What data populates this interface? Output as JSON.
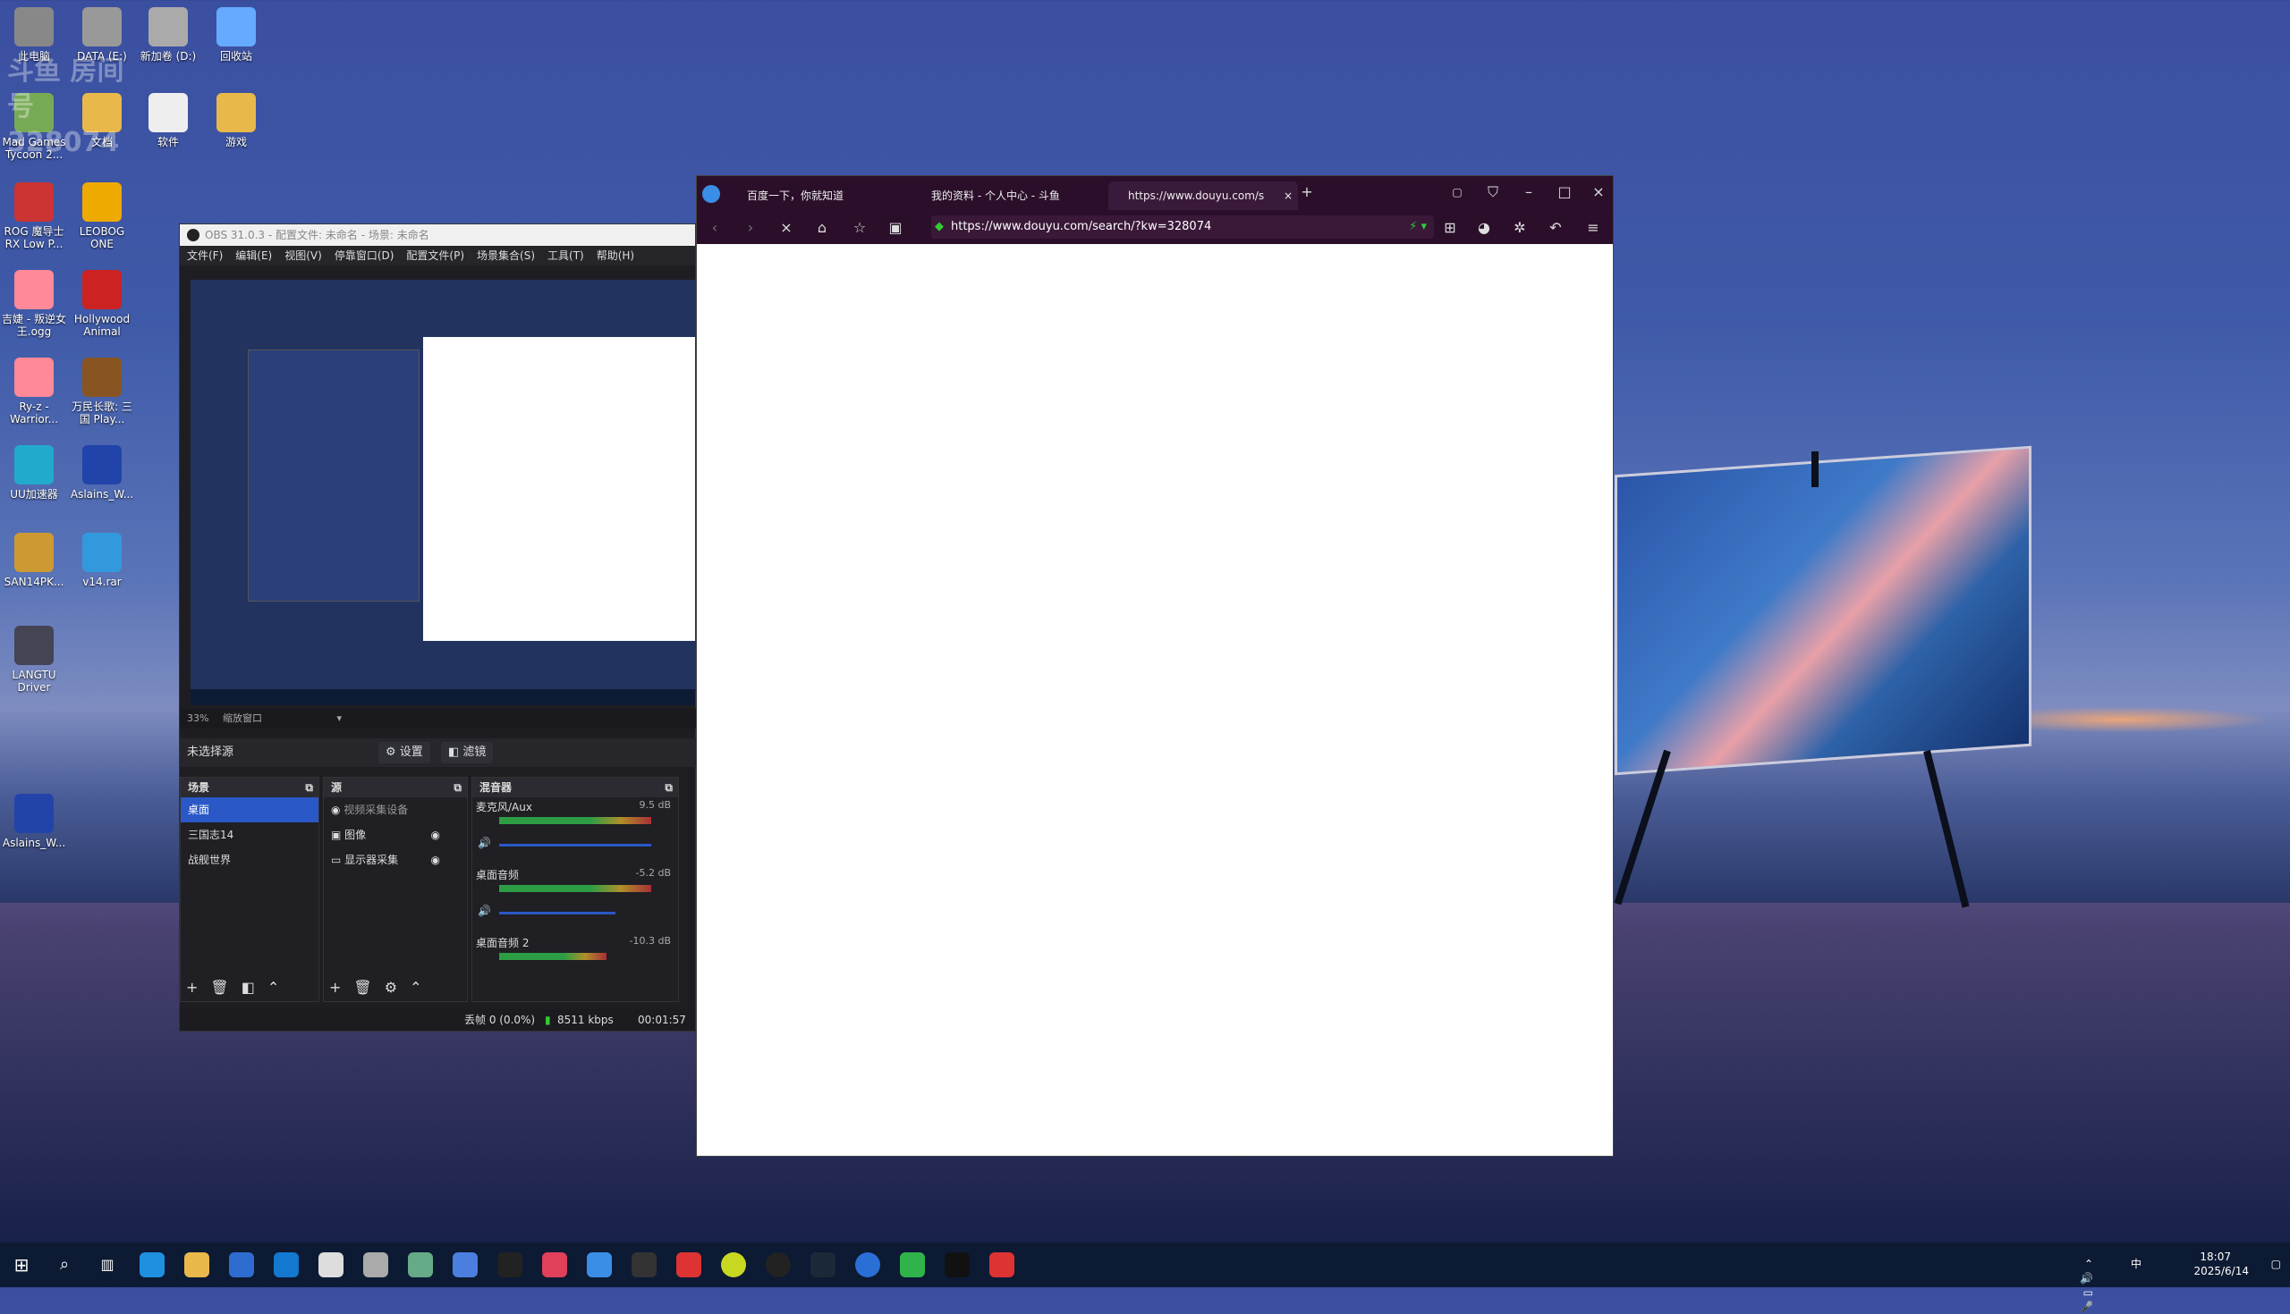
{
  "desktop": {
    "icons": [
      {
        "label": "此电脑"
      },
      {
        "label": "DATA (E:)"
      },
      {
        "label": "新加卷 (D:)"
      },
      {
        "label": "回收站"
      },
      {
        "label": "Mad Games Tycoon 2..."
      },
      {
        "label": "文档"
      },
      {
        "label": "软件"
      },
      {
        "label": "游戏"
      },
      {
        "label": "ROG 魔导士 RX Low P..."
      },
      {
        "label": "LEOBOG ONE"
      },
      {
        "label": "吉婕 - 叛逆女王.ogg"
      },
      {
        "label": "Hollywood Animal"
      },
      {
        "label": "Ry-z - Warrior..."
      },
      {
        "label": "万民长歌: 三国 Play..."
      },
      {
        "label": "UU加速器"
      },
      {
        "label": "Aslains_W..."
      },
      {
        "label": "SAN14PK..."
      },
      {
        "label": "v14.rar"
      },
      {
        "label": "LANGTU Driver"
      },
      {
        "label": "Aslains_W..."
      }
    ],
    "watermark": "斗鱼 房间号 328074"
  },
  "obs": {
    "title": "OBS 31.0.3 - 配置文件: 未命名 - 场景: 未命名",
    "menu": [
      "文件(F)",
      "编辑(E)",
      "视图(V)",
      "停靠窗口(D)",
      "配置文件(P)",
      "场景集合(S)",
      "工具(T)",
      "帮助(H)"
    ],
    "zoom": "33%",
    "zoom_mode": "缩放窗口",
    "context_label": "未选择源",
    "settings_btn": "设置",
    "filters_btn": "滤镜",
    "scenes_title": "场景",
    "scenes": [
      "桌面",
      "三国志14",
      "战舰世界"
    ],
    "sources_title": "源",
    "sources": [
      "视频采集设备",
      "图像",
      "显示器采集"
    ],
    "mixer_title": "混音器",
    "mixer": [
      {
        "name": "麦克风/Aux",
        "db": "9.5 dB"
      },
      {
        "name": "桌面音频",
        "db": "-5.2 dB"
      },
      {
        "name": "桌面音频 2",
        "db": "-10.3 dB"
      }
    ],
    "status_dropped": "丢帧 0 (0.0%)",
    "status_bitrate": "8511 kbps",
    "status_time": "00:01:57"
  },
  "browser": {
    "tabs": [
      {
        "label": "百度一下，你就知道"
      },
      {
        "label": "我的资料 - 个人中心 - 斗鱼"
      },
      {
        "label": "https://www.douyu.com/s"
      }
    ],
    "url": "https://www.douyu.com/search/?kw=328074"
  },
  "taskbar": {
    "time": "18:07",
    "date": "2025/6/14",
    "ime": "中"
  }
}
